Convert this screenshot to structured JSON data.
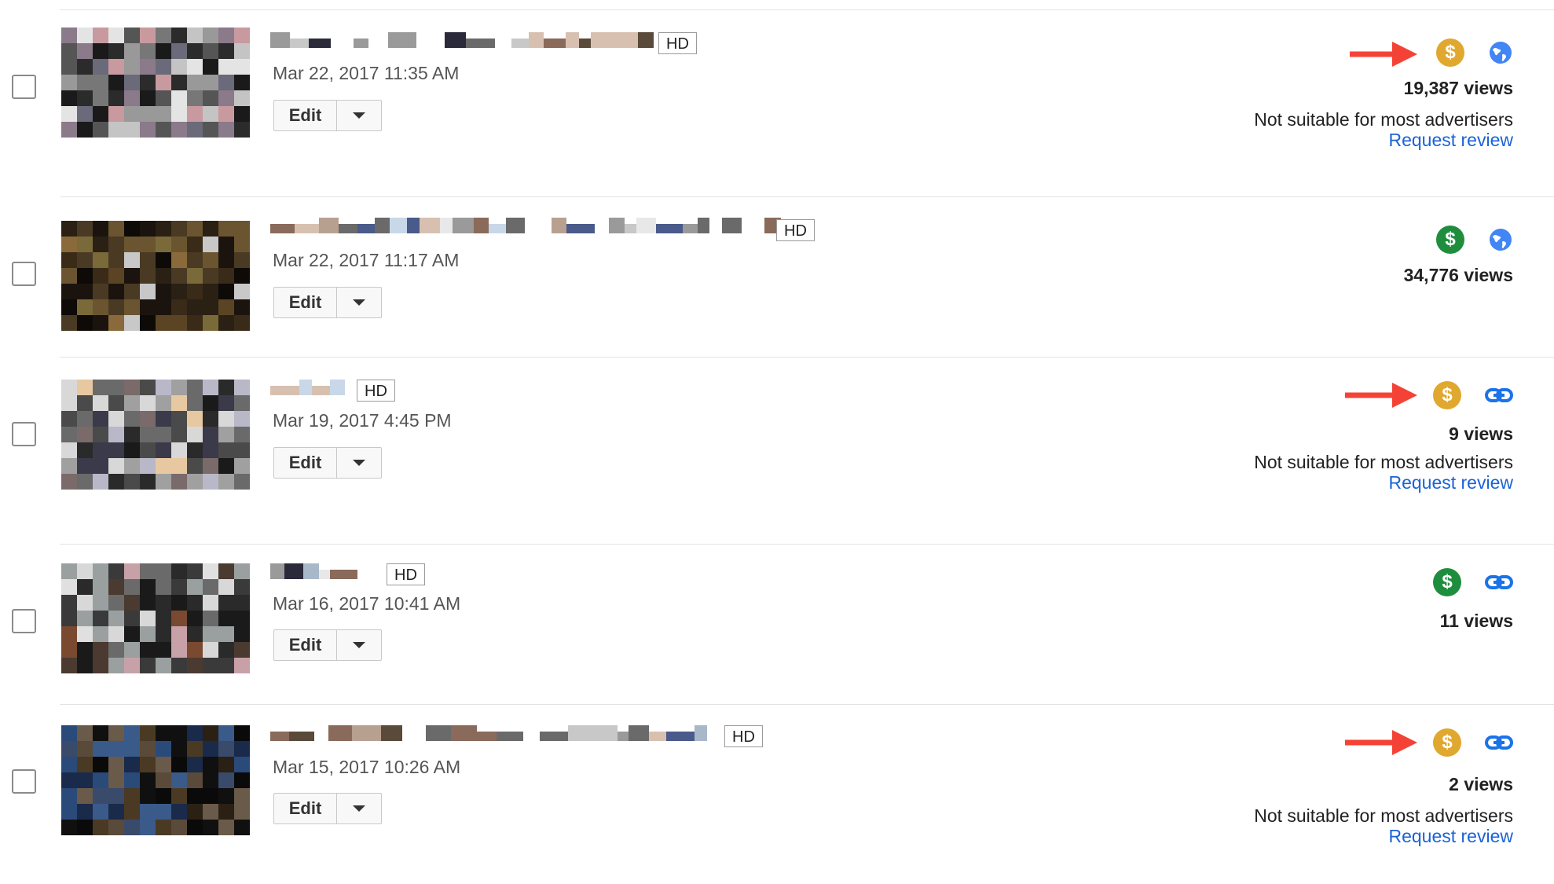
{
  "badge_label": "HD",
  "edit_label": "Edit",
  "colors": {
    "monetized_limited": "#e0a82e",
    "monetized_on": "#1e8e3e",
    "privacy_icon": "#4285f4",
    "annotation_arrow": "#f44336",
    "link": "#1a63d6"
  },
  "videos": [
    {
      "date": "Mar 22, 2017 11:35 AM",
      "views": "19,387 views",
      "monetization_icon": "yellow-dollar-icon",
      "privacy_icon": "globe-icon",
      "notice": "Not suitable for most advertisers",
      "request_review": "Request review",
      "arrow": true
    },
    {
      "date": "Mar 22, 2017 11:17 AM",
      "views": "34,776 views",
      "monetization_icon": "green-dollar-icon",
      "privacy_icon": "globe-icon",
      "arrow": false
    },
    {
      "date": "Mar 19, 2017 4:45 PM",
      "views": "9 views",
      "monetization_icon": "yellow-dollar-icon",
      "privacy_icon": "link-icon",
      "notice": "Not suitable for most advertisers",
      "request_review": "Request review",
      "arrow": true
    },
    {
      "date": "Mar 16, 2017 10:41 AM",
      "views": "11 views",
      "monetization_icon": "green-dollar-icon",
      "privacy_icon": "link-icon",
      "arrow": false
    },
    {
      "date": "Mar 15, 2017 10:26 AM",
      "views": "2 views",
      "monetization_icon": "yellow-dollar-icon",
      "privacy_icon": "link-icon",
      "notice": "Not suitable for most advertisers",
      "request_review": "Request review",
      "arrow": true
    }
  ]
}
